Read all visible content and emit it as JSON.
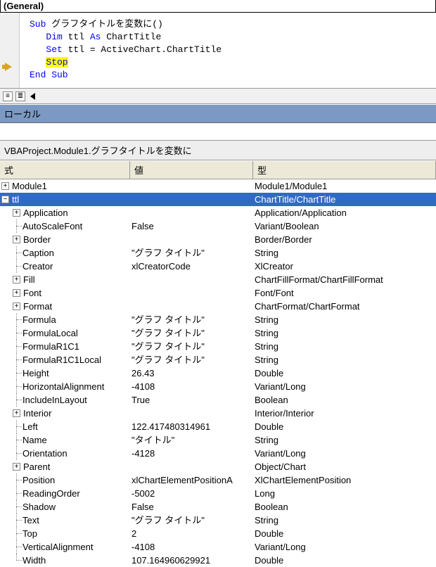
{
  "dropdown": {
    "label": "(General)"
  },
  "code": {
    "sub_kw": "Sub",
    "sub_name": " グラフタイトルを変数に()",
    "dim_kw": "Dim",
    "dim_rest1": " ttl ",
    "as_kw": "As",
    "dim_rest2": " ChartTitle",
    "set_kw": "Set",
    "set_rest": " ttl = ActiveChart.ChartTitle",
    "stop_kw": "Stop",
    "end_kw": "End Sub"
  },
  "locals_panel_title": "ローカル",
  "context": "VBAProject.Module1.グラフタイトルを変数に",
  "headers": {
    "expr": "式",
    "value": "値",
    "type": "型"
  },
  "rows": [
    {
      "depth": 0,
      "icon": "plus",
      "name": "Module1",
      "value": "",
      "type": "Module1/Module1",
      "selected": false
    },
    {
      "depth": 0,
      "icon": "minus",
      "name": "ttl",
      "value": "",
      "type": "ChartTitle/ChartTitle",
      "selected": true
    },
    {
      "depth": 1,
      "icon": "plus",
      "name": "Application",
      "value": "",
      "type": "Application/Application"
    },
    {
      "depth": 1,
      "icon": "none",
      "name": "AutoScaleFont",
      "value": "False",
      "type": "Variant/Boolean"
    },
    {
      "depth": 1,
      "icon": "plus",
      "name": "Border",
      "value": "",
      "type": "Border/Border"
    },
    {
      "depth": 1,
      "icon": "none",
      "name": "Caption",
      "value": "\"グラフ タイトル\"",
      "type": "String"
    },
    {
      "depth": 1,
      "icon": "none",
      "name": "Creator",
      "value": "xlCreatorCode",
      "type": "XlCreator"
    },
    {
      "depth": 1,
      "icon": "plus",
      "name": "Fill",
      "value": "",
      "type": "ChartFillFormat/ChartFillFormat"
    },
    {
      "depth": 1,
      "icon": "plus",
      "name": "Font",
      "value": "",
      "type": "Font/Font"
    },
    {
      "depth": 1,
      "icon": "plus",
      "name": "Format",
      "value": "",
      "type": "ChartFormat/ChartFormat"
    },
    {
      "depth": 1,
      "icon": "none",
      "name": "Formula",
      "value": "\"グラフ タイトル\"",
      "type": "String"
    },
    {
      "depth": 1,
      "icon": "none",
      "name": "FormulaLocal",
      "value": "\"グラフ タイトル\"",
      "type": "String"
    },
    {
      "depth": 1,
      "icon": "none",
      "name": "FormulaR1C1",
      "value": "\"グラフ タイトル\"",
      "type": "String"
    },
    {
      "depth": 1,
      "icon": "none",
      "name": "FormulaR1C1Local",
      "value": "\"グラフ タイトル\"",
      "type": "String"
    },
    {
      "depth": 1,
      "icon": "none",
      "name": "Height",
      "value": "26.43",
      "type": "Double"
    },
    {
      "depth": 1,
      "icon": "none",
      "name": "HorizontalAlignment",
      "value": "-4108",
      "type": "Variant/Long"
    },
    {
      "depth": 1,
      "icon": "none",
      "name": "IncludeInLayout",
      "value": "True",
      "type": "Boolean"
    },
    {
      "depth": 1,
      "icon": "plus",
      "name": "Interior",
      "value": "",
      "type": "Interior/Interior"
    },
    {
      "depth": 1,
      "icon": "none",
      "name": "Left",
      "value": "122.417480314961",
      "type": "Double"
    },
    {
      "depth": 1,
      "icon": "none",
      "name": "Name",
      "value": "\"タイトル\"",
      "type": "String"
    },
    {
      "depth": 1,
      "icon": "none",
      "name": "Orientation",
      "value": "-4128",
      "type": "Variant/Long"
    },
    {
      "depth": 1,
      "icon": "plus",
      "name": "Parent",
      "value": "",
      "type": "Object/Chart"
    },
    {
      "depth": 1,
      "icon": "none",
      "name": "Position",
      "value": "xlChartElementPositionA",
      "type": "XlChartElementPosition"
    },
    {
      "depth": 1,
      "icon": "none",
      "name": "ReadingOrder",
      "value": "-5002",
      "type": "Long"
    },
    {
      "depth": 1,
      "icon": "none",
      "name": "Shadow",
      "value": "False",
      "type": "Boolean"
    },
    {
      "depth": 1,
      "icon": "none",
      "name": "Text",
      "value": "\"グラフ タイトル\"",
      "type": "String"
    },
    {
      "depth": 1,
      "icon": "none",
      "name": "Top",
      "value": "2",
      "type": "Double"
    },
    {
      "depth": 1,
      "icon": "none",
      "name": "VerticalAlignment",
      "value": "-4108",
      "type": "Variant/Long"
    },
    {
      "depth": 1,
      "icon": "none",
      "name": "Width",
      "value": "107.164960629921",
      "type": "Double",
      "last": true
    }
  ]
}
